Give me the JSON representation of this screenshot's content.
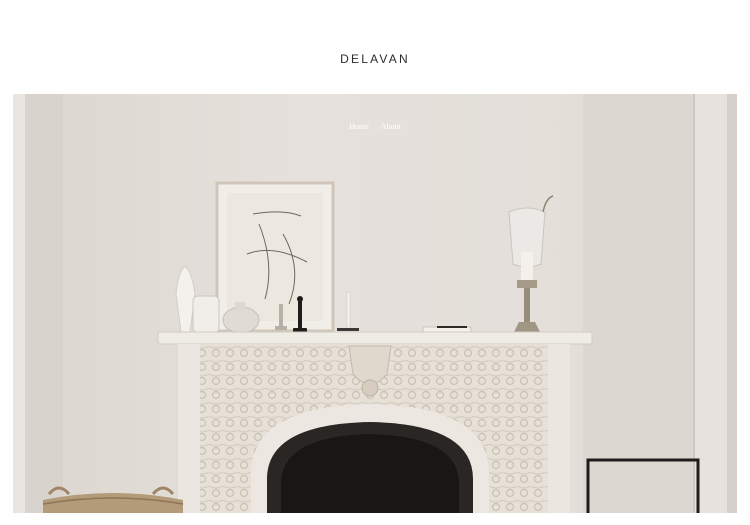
{
  "site": {
    "logo": "DELAVAN"
  },
  "nav": {
    "items": [
      "Home",
      "About"
    ]
  },
  "hero": {
    "image": "fireplace-mantel-photo",
    "colors": {
      "wall": "#e4dfda",
      "marble": "#ebe6df",
      "grate": "#2a2624"
    }
  }
}
